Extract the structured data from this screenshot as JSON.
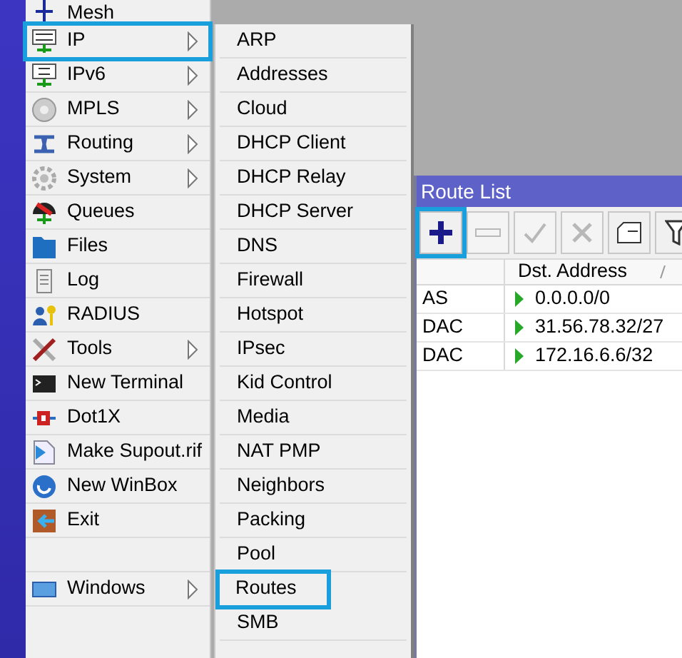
{
  "main_menu": {
    "items": [
      {
        "kind": "item",
        "label": "Mesh",
        "has_submenu": false,
        "selected": false
      },
      {
        "kind": "item",
        "label": "IP",
        "has_submenu": true,
        "selected": true
      },
      {
        "kind": "item",
        "label": "IPv6",
        "has_submenu": true,
        "selected": false
      },
      {
        "kind": "item",
        "label": "MPLS",
        "has_submenu": true,
        "selected": false
      },
      {
        "kind": "item",
        "label": "Routing",
        "has_submenu": true,
        "selected": false
      },
      {
        "kind": "item",
        "label": "System",
        "has_submenu": true,
        "selected": false
      },
      {
        "kind": "item",
        "label": "Queues",
        "has_submenu": false,
        "selected": false
      },
      {
        "kind": "item",
        "label": "Files",
        "has_submenu": false,
        "selected": false
      },
      {
        "kind": "item",
        "label": "Log",
        "has_submenu": false,
        "selected": false
      },
      {
        "kind": "item",
        "label": "RADIUS",
        "has_submenu": false,
        "selected": false
      },
      {
        "kind": "item",
        "label": "Tools",
        "has_submenu": true,
        "selected": false
      },
      {
        "kind": "item",
        "label": "New Terminal",
        "has_submenu": false,
        "selected": false
      },
      {
        "kind": "item",
        "label": "Dot1X",
        "has_submenu": false,
        "selected": false
      },
      {
        "kind": "item",
        "label": "Make Supout.rif",
        "has_submenu": false,
        "selected": false
      },
      {
        "kind": "item",
        "label": "New WinBox",
        "has_submenu": false,
        "selected": false
      },
      {
        "kind": "item",
        "label": "Exit",
        "has_submenu": false,
        "selected": false
      },
      {
        "kind": "spacer"
      },
      {
        "kind": "item",
        "label": "Windows",
        "has_submenu": true,
        "selected": false
      }
    ]
  },
  "ip_submenu": {
    "items": [
      {
        "label": "ARP",
        "selected": false
      },
      {
        "label": "Addresses",
        "selected": false
      },
      {
        "label": "Cloud",
        "selected": false
      },
      {
        "label": "DHCP Client",
        "selected": false
      },
      {
        "label": "DHCP Relay",
        "selected": false
      },
      {
        "label": "DHCP Server",
        "selected": false
      },
      {
        "label": "DNS",
        "selected": false
      },
      {
        "label": "Firewall",
        "selected": false
      },
      {
        "label": "Hotspot",
        "selected": false
      },
      {
        "label": "IPsec",
        "selected": false
      },
      {
        "label": "Kid Control",
        "selected": false
      },
      {
        "label": "Media",
        "selected": false
      },
      {
        "label": "NAT PMP",
        "selected": false
      },
      {
        "label": "Neighbors",
        "selected": false
      },
      {
        "label": "Packing",
        "selected": false
      },
      {
        "label": "Pool",
        "selected": false
      },
      {
        "label": "Routes",
        "selected": true
      },
      {
        "label": "SMB",
        "selected": false
      }
    ]
  },
  "route_list": {
    "title": "Route List",
    "toolbar": [
      {
        "kind": "add",
        "selected": true,
        "disabled": false
      },
      {
        "kind": "remove",
        "selected": false,
        "disabled": true
      },
      {
        "kind": "enable",
        "selected": false,
        "disabled": true
      },
      {
        "kind": "disable",
        "selected": false,
        "disabled": true
      },
      {
        "kind": "comment",
        "selected": false,
        "disabled": false
      },
      {
        "kind": "filter",
        "selected": false,
        "disabled": false
      }
    ],
    "columns": [
      {
        "label": "Dst. Address",
        "sorted": true
      }
    ],
    "rows": [
      {
        "flags": "AS",
        "dst_address": "0.0.0.0/0"
      },
      {
        "flags": "DAC",
        "dst_address": "31.56.78.32/27"
      },
      {
        "flags": "DAC",
        "dst_address": "172.16.6.6/32"
      }
    ]
  }
}
